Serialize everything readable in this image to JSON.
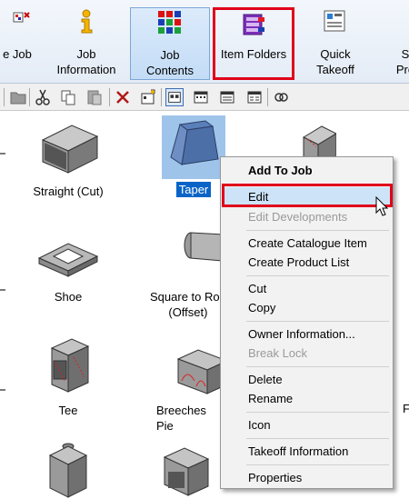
{
  "ribbon": {
    "buttons": [
      {
        "name": "add-job-button",
        "label": "e Job"
      },
      {
        "name": "job-information-button",
        "label": "Job\nInformation"
      },
      {
        "name": "job-contents-button",
        "label": "Job\nContents"
      },
      {
        "name": "item-folders-button",
        "label": "Item Folders"
      },
      {
        "name": "quick-takeoff-button",
        "label": "Quick\nTakeoff"
      },
      {
        "name": "partial-right-button",
        "label": "S\nPro"
      }
    ]
  },
  "toolbar": {
    "icons": [
      "folder-icon",
      "cut-icon",
      "copy-icon",
      "paste-icon",
      "delete-icon",
      "properties-icon",
      "large-icons-view-icon",
      "small-icons-view-icon",
      "list-view-icon",
      "details-view-icon",
      "find-icon"
    ]
  },
  "items": [
    {
      "label": "Straight (Cut)",
      "icon": "straight-duct-icon"
    },
    {
      "label": "Taper",
      "icon": "taper-duct-icon"
    },
    {
      "label": "",
      "icon": "square-duct-partial-icon"
    },
    {
      "label": "Shoe",
      "icon": "shoe-duct-icon"
    },
    {
      "label": "Square to Rou\n(Offset)",
      "icon": "square-to-round-icon"
    },
    {
      "label": "Tee",
      "icon": "tee-duct-icon"
    },
    {
      "label": "Breeches Pie",
      "icon": "breeches-piece-icon"
    },
    {
      "label": "F",
      "icon": ""
    },
    {
      "label": "",
      "icon": "box-duct-icon"
    },
    {
      "label": "",
      "icon": "bend-duct-icon"
    }
  ],
  "context_menu": {
    "items": [
      {
        "label": "Add To Job",
        "style": "bold"
      },
      {
        "label": "Edit",
        "style": "hover"
      },
      {
        "label": "Edit Developments",
        "style": "disabled"
      },
      {
        "label": "Create Catalogue Item",
        "style": ""
      },
      {
        "label": "Create Product List",
        "style": ""
      },
      {
        "label": "Cut",
        "style": ""
      },
      {
        "label": "Copy",
        "style": ""
      },
      {
        "label": "Owner Information...",
        "style": ""
      },
      {
        "label": "Break Lock",
        "style": "disabled"
      },
      {
        "label": "Delete",
        "style": ""
      },
      {
        "label": "Rename",
        "style": ""
      },
      {
        "label": "Icon",
        "style": ""
      },
      {
        "label": "Takeoff Information",
        "style": ""
      },
      {
        "label": "Properties",
        "style": ""
      }
    ]
  },
  "colors": {
    "highlight": "#e0001b",
    "selection": "#0a64c8",
    "menu_hover": "#cde3f7"
  }
}
